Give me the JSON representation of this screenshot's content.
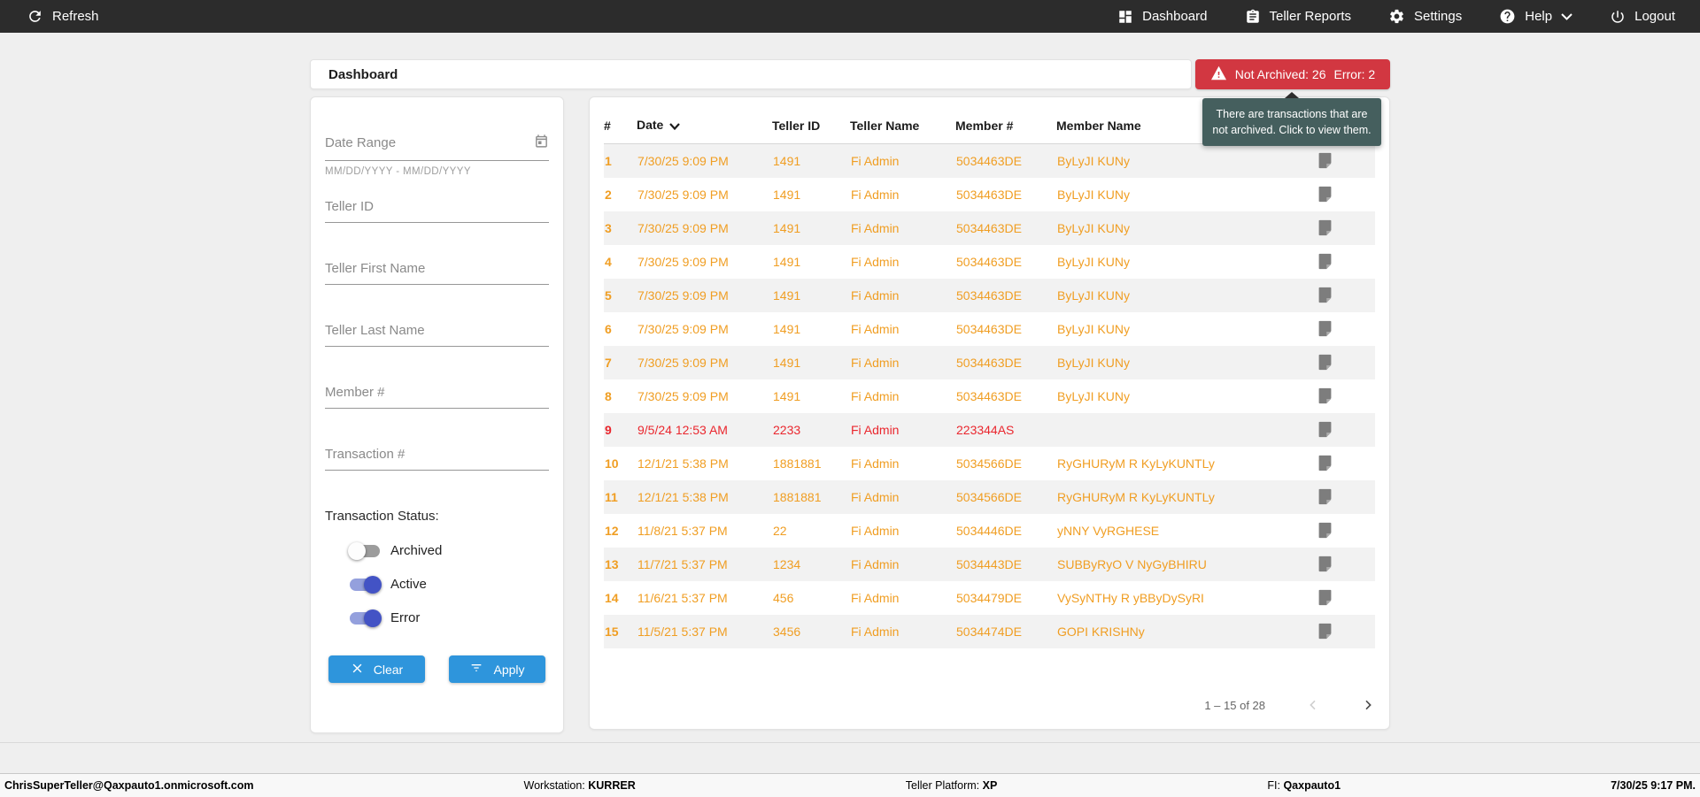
{
  "navbar": {
    "refresh_label": "Refresh",
    "items": [
      {
        "label": "Dashboard"
      },
      {
        "label": "Teller Reports"
      },
      {
        "label": "Settings"
      },
      {
        "label": "Help"
      },
      {
        "label": "Logout"
      }
    ]
  },
  "page": {
    "title": "Dashboard"
  },
  "alert": {
    "not_archived_label": "Not Archived: 26",
    "error_label": "Error: 2",
    "tooltip": "There are transactions that are not archived. Click to view them."
  },
  "filters": {
    "date_range": {
      "label": "Date Range",
      "hint": "MM/DD/YYYY - MM/DD/YYYY"
    },
    "fields": [
      "Teller ID",
      "Teller First Name",
      "Teller Last Name",
      "Member #",
      "Transaction #"
    ],
    "status": {
      "label": "Transaction Status:",
      "toggles": [
        {
          "label": "Archived",
          "on": false
        },
        {
          "label": "Active",
          "on": true
        },
        {
          "label": "Error",
          "on": true
        }
      ]
    },
    "clear_label": "Clear",
    "apply_label": "Apply"
  },
  "table": {
    "columns": [
      "#",
      "Date",
      "Teller ID",
      "Teller Name",
      "Member #",
      "Member Name"
    ],
    "sorted_by": "Date",
    "sort_direction": "desc",
    "rows": [
      {
        "num": "1",
        "date": "7/30/25 9:09 PM",
        "teller_id": "1491",
        "teller_name": "Fi Admin",
        "member_num": "5034463DE",
        "member_name": "ByLyJI KUNy",
        "status": "active"
      },
      {
        "num": "2",
        "date": "7/30/25 9:09 PM",
        "teller_id": "1491",
        "teller_name": "Fi Admin",
        "member_num": "5034463DE",
        "member_name": "ByLyJI KUNy",
        "status": "active"
      },
      {
        "num": "3",
        "date": "7/30/25 9:09 PM",
        "teller_id": "1491",
        "teller_name": "Fi Admin",
        "member_num": "5034463DE",
        "member_name": "ByLyJI KUNy",
        "status": "active"
      },
      {
        "num": "4",
        "date": "7/30/25 9:09 PM",
        "teller_id": "1491",
        "teller_name": "Fi Admin",
        "member_num": "5034463DE",
        "member_name": "ByLyJI KUNy",
        "status": "active"
      },
      {
        "num": "5",
        "date": "7/30/25 9:09 PM",
        "teller_id": "1491",
        "teller_name": "Fi Admin",
        "member_num": "5034463DE",
        "member_name": "ByLyJI KUNy",
        "status": "active"
      },
      {
        "num": "6",
        "date": "7/30/25 9:09 PM",
        "teller_id": "1491",
        "teller_name": "Fi Admin",
        "member_num": "5034463DE",
        "member_name": "ByLyJI KUNy",
        "status": "active"
      },
      {
        "num": "7",
        "date": "7/30/25 9:09 PM",
        "teller_id": "1491",
        "teller_name": "Fi Admin",
        "member_num": "5034463DE",
        "member_name": "ByLyJI KUNy",
        "status": "active"
      },
      {
        "num": "8",
        "date": "7/30/25 9:09 PM",
        "teller_id": "1491",
        "teller_name": "Fi Admin",
        "member_num": "5034463DE",
        "member_name": "ByLyJI KUNy",
        "status": "active"
      },
      {
        "num": "9",
        "date": "9/5/24 12:53 AM",
        "teller_id": "2233",
        "teller_name": "Fi Admin",
        "member_num": "223344AS",
        "member_name": "",
        "status": "error"
      },
      {
        "num": "10",
        "date": "12/1/21 5:38 PM",
        "teller_id": "1881881",
        "teller_name": "Fi Admin",
        "member_num": "5034566DE",
        "member_name": "RyGHURyM R KyLyKUNTLy",
        "status": "active"
      },
      {
        "num": "11",
        "date": "12/1/21 5:38 PM",
        "teller_id": "1881881",
        "teller_name": "Fi Admin",
        "member_num": "5034566DE",
        "member_name": "RyGHURyM R KyLyKUNTLy",
        "status": "active"
      },
      {
        "num": "12",
        "date": "11/8/21 5:37 PM",
        "teller_id": "22",
        "teller_name": "Fi Admin",
        "member_num": "5034446DE",
        "member_name": "yNNY VyRGHESE",
        "status": "active"
      },
      {
        "num": "13",
        "date": "11/7/21 5:37 PM",
        "teller_id": "1234",
        "teller_name": "Fi Admin",
        "member_num": "5034443DE",
        "member_name": "SUBByRyO V NyGyBHIRU",
        "status": "active"
      },
      {
        "num": "14",
        "date": "11/6/21 5:37 PM",
        "teller_id": "456",
        "teller_name": "Fi Admin",
        "member_num": "5034479DE",
        "member_name": "VySyNTHy R yBByDySyRI",
        "status": "active"
      },
      {
        "num": "15",
        "date": "11/5/21 5:37 PM",
        "teller_id": "3456",
        "teller_name": "Fi Admin",
        "member_num": "5034474DE",
        "member_name": "GOPI KRISHNy",
        "status": "active"
      }
    ],
    "pagination": {
      "range": "1 – 15 of 28"
    }
  },
  "footer": {
    "user": "ChrisSuperTeller@Qaxpauto1.onmicrosoft.com",
    "workstation_label": "Workstation:",
    "workstation_value": "KURRER",
    "platform_label": "Teller Platform:",
    "platform_value": "XP",
    "fi_label": "FI:",
    "fi_value": "Qaxpauto1",
    "timestamp": "7/30/25 9:17 PM."
  },
  "colors": {
    "navbar_bg": "#2c2c2c",
    "badge_red": "#d23741",
    "tooltip_bg": "#455f5e",
    "row_active_orange": "#f09e23",
    "row_error_red": "#ea272e",
    "button_blue": "#2e95dc",
    "toggle_on": "#4353c5"
  }
}
